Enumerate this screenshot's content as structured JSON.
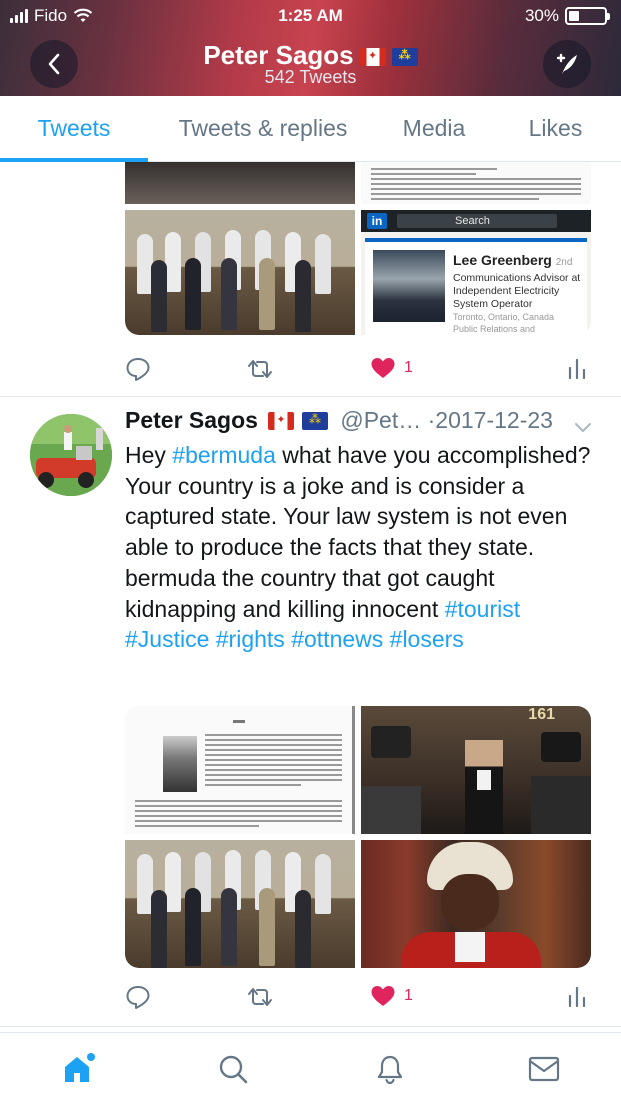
{
  "status_bar": {
    "carrier": "Fido",
    "time": "1:25 AM",
    "battery": "30%",
    "battery_level": 0.3
  },
  "header": {
    "name": "Peter Sagos",
    "tweet_count": "542 Tweets",
    "back_icon": "chevron-left-icon",
    "compose_icon": "compose-feather-icon"
  },
  "tabs": [
    {
      "label": "Tweets",
      "active": true
    },
    {
      "label": "Tweets & replies",
      "active": false
    },
    {
      "label": "Media",
      "active": false
    },
    {
      "label": "Likes",
      "active": false
    }
  ],
  "colors": {
    "accent": "#1da1f2",
    "muted": "#657786",
    "like": "#e0245e"
  },
  "prev_tweet": {
    "linkedin": {
      "search": "Search",
      "name": "Lee Greenberg",
      "degree": "2nd",
      "title": "Communications Advisor at Independent Electricity System Operator",
      "location": "Toronto, Ontario, Canada",
      "industry": "Public Relations and Communications"
    },
    "likes": "1"
  },
  "tweet": {
    "name": "Peter Sagos",
    "handle": "@Pet…",
    "separator": "·",
    "date": "2017-12-23",
    "text_parts": [
      {
        "t": "Hey ",
        "tag": false
      },
      {
        "t": "#bermuda",
        "tag": true
      },
      {
        "t": " what have you accomplished? Your country is a joke and is consider a captured state. Your law system is not even able to produce the facts that they state. bermuda the country that got caught kidnapping and killing innocent ",
        "tag": false
      },
      {
        "t": "#tourist",
        "tag": true
      },
      {
        "t": " ",
        "tag": false
      },
      {
        "t": "#Justice",
        "tag": true
      },
      {
        "t": " ",
        "tag": false
      },
      {
        "t": "#rights",
        "tag": true
      },
      {
        "t": " ",
        "tag": false
      },
      {
        "t": "#ottnews",
        "tag": true
      },
      {
        "t": " ",
        "tag": false
      },
      {
        "t": "#losers",
        "tag": true
      }
    ],
    "press_sign": "161",
    "likes": "1"
  },
  "bottom_nav": [
    "home-icon",
    "search-icon",
    "notifications-bell-icon",
    "messages-envelope-icon"
  ]
}
